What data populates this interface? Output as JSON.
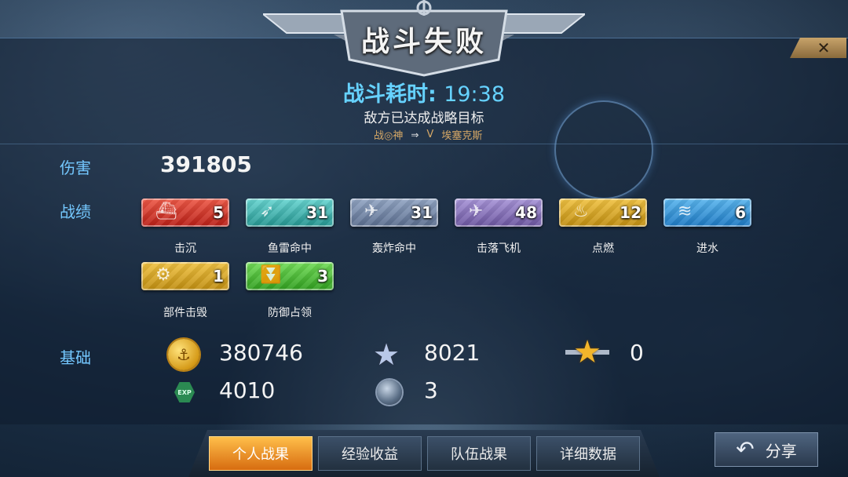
{
  "header": {
    "title": "战斗失败"
  },
  "battle": {
    "duration_label": "战斗耗时:",
    "duration_value": "19:38",
    "reason": "敌方已达成战略目标",
    "player_name": "战◎神",
    "vs": "V",
    "enemy_name": "埃塞克斯"
  },
  "damage": {
    "label": "伤害",
    "value": "391805"
  },
  "record": {
    "label": "战绩",
    "items": [
      {
        "name": "击沉",
        "value": "5",
        "color": "#d8352a",
        "icon": "warship-icon"
      },
      {
        "name": "鱼雷命中",
        "value": "31",
        "color": "#3fb6b1",
        "icon": "torpedo-icon"
      },
      {
        "name": "轰炸命中",
        "value": "31",
        "color": "#7286a8",
        "icon": "bomber-icon"
      },
      {
        "name": "击落飞机",
        "value": "48",
        "color": "#8674bd",
        "icon": "plane-icon"
      },
      {
        "name": "点燃",
        "value": "12",
        "color": "#dea52a",
        "icon": "fire-icon"
      },
      {
        "name": "进水",
        "value": "6",
        "color": "#2f95dc",
        "icon": "water-icon"
      },
      {
        "name": "部件击毁",
        "value": "1",
        "color": "#dea52a",
        "icon": "gear-icon"
      },
      {
        "name": "防御占领",
        "value": "3",
        "color": "#4cbd37",
        "icon": "chevron-down-icon"
      }
    ]
  },
  "base": {
    "label": "基础",
    "coins": "380746",
    "exp": "4010",
    "exp_icon_text": "EXP",
    "silver_star": "8021",
    "orb": "3",
    "gold_star": "0"
  },
  "tabs": [
    "个人战果",
    "经验收益",
    "队伍战果",
    "详细数据"
  ],
  "share": {
    "label": "分享"
  },
  "close": {
    "glyph": "✕"
  }
}
